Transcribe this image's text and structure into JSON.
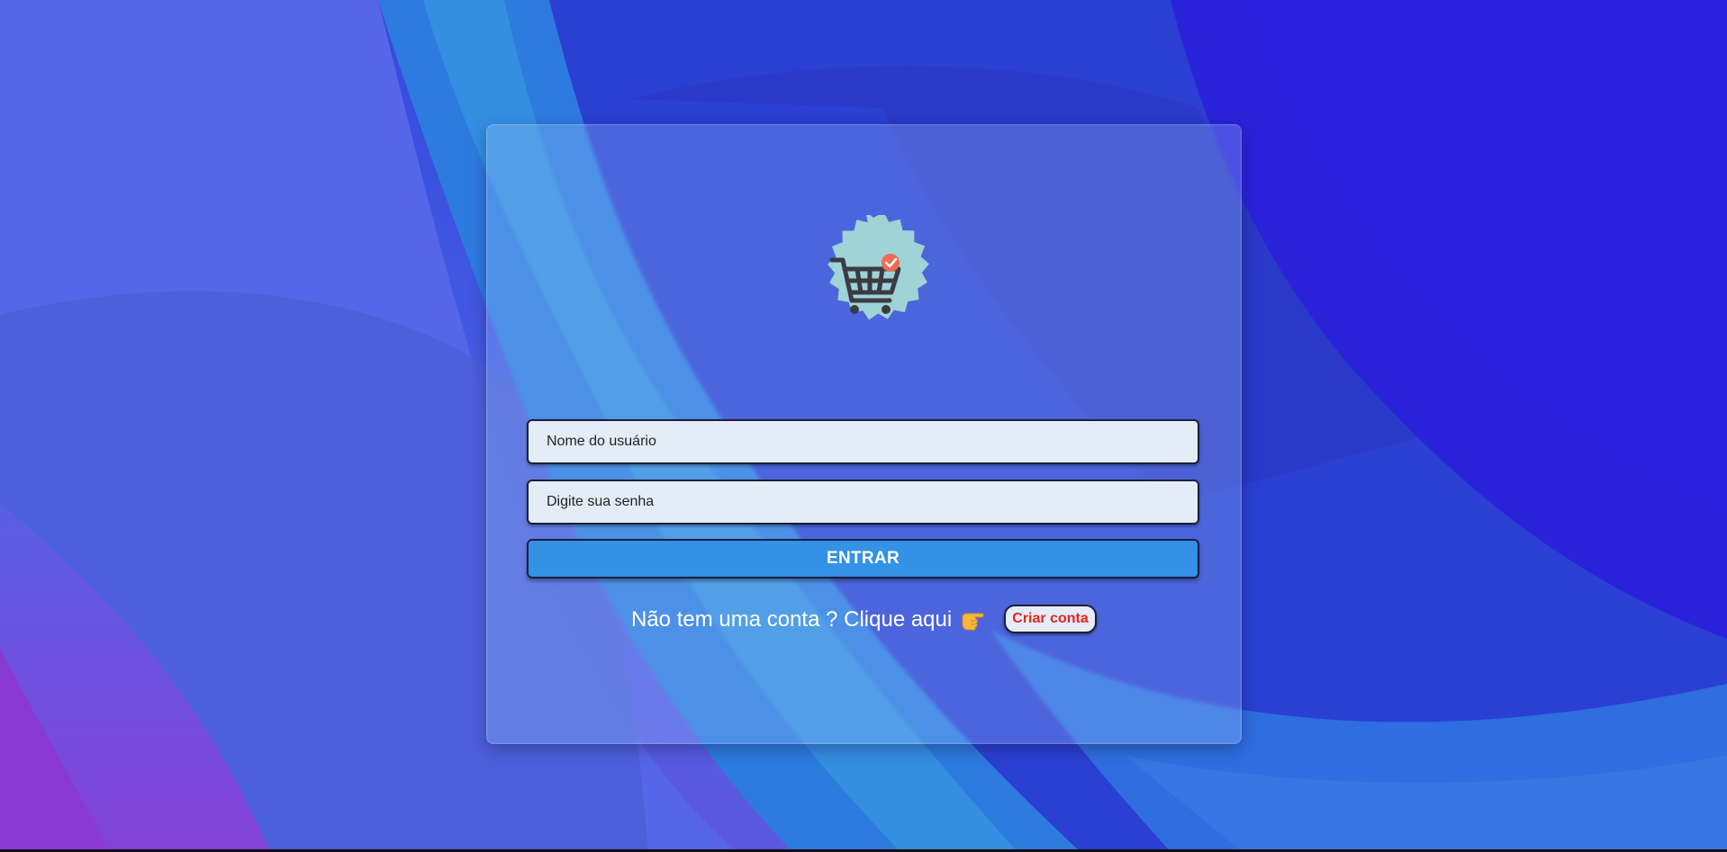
{
  "login": {
    "username_placeholder": "Nome do usuário",
    "password_placeholder": "Digite sua senha",
    "enter_label": "ENTRAR",
    "signup_prompt": "Não tem uma conta ? Clique aqui",
    "signup_button_label": "Criar conta"
  },
  "icons": {
    "logo": "shopping-cart-check-badge",
    "pointer": "backhand-index-pointing-right"
  },
  "colors": {
    "background_primary": "#3d4fe0",
    "enter_button": "#3391e6",
    "create_account_text": "#e5261c",
    "badge": "#9fd3d6",
    "badge_check": "#f06a55"
  }
}
